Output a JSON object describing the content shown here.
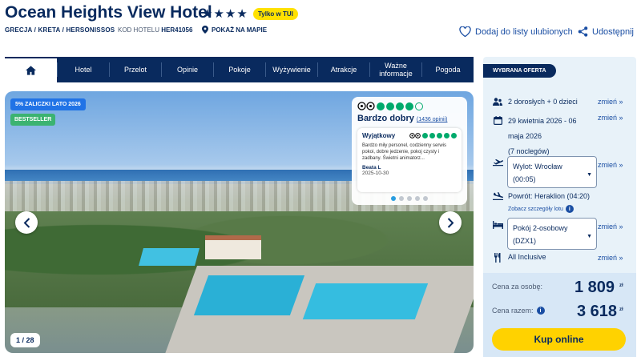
{
  "hotel": {
    "name": "Ocean Heights View Hotel",
    "stars": "★★★★",
    "badge": "Tylko w TUI",
    "breadcrumb": "GRECJA / KRETA / HERSONISSOS",
    "code_label": "KOD HOTELU",
    "code": "HER41056",
    "map_label": "POKAŻ NA MAPIE"
  },
  "actions": {
    "favorites": "Dodaj do listy ulubionych",
    "share": "Udostępnij"
  },
  "nav": {
    "items": [
      "Hotel",
      "Przelot",
      "Opinie",
      "Pokoje",
      "Wyżywienie",
      "Atrakcje",
      "Ważne informacje",
      "Pogoda"
    ]
  },
  "gallery": {
    "promo_badge": "5% ZALICZKI LATO 2026",
    "bestseller_badge": "BESTSELLER",
    "counter": "1 / 28"
  },
  "review": {
    "rating_dots": 4,
    "title": "Bardzo dobry",
    "count": "(1436 opinii)",
    "card_rating_word": "Wyjątkowy",
    "card_dots": 5,
    "text": "Bardzo miły personel, codzienny serwis pokoi, dobre jedzenie, pokoj czysty i zadbany. Świetni animatorz...",
    "author": "Beata L",
    "date": "2025-10-30",
    "pager_count": 5,
    "pager_active": 1
  },
  "offer": {
    "header": "WYBRANA OFERTA",
    "change_label": "zmień »",
    "guests": "2 dorosłych + 0 dzieci",
    "dates_line1": "29 kwietnia 2026 - 06",
    "dates_line2": "maja 2026",
    "nights": "(7 noclegów)",
    "departure_line1": "Wylot: Wrocław",
    "departure_line2": "(00:05)",
    "return": "Powrót: Heraklion (04:20)",
    "flight_details": "Zobacz szczegóły lotu",
    "room_line1": "Pokój 2-osobowy",
    "room_line2": "(DZX1)",
    "board": "All Inclusive"
  },
  "price": {
    "per_person_label": "Cena za osobę:",
    "per_person": "1 809",
    "total_label": "Cena razem:",
    "total": "3 618",
    "currency": "zł",
    "book_label": "Kup online"
  },
  "colors": {
    "navy": "#092a5e",
    "accent_yellow": "#ffd200",
    "tripadvisor_green": "#00aa6c",
    "link_blue": "#1a4ea3"
  }
}
